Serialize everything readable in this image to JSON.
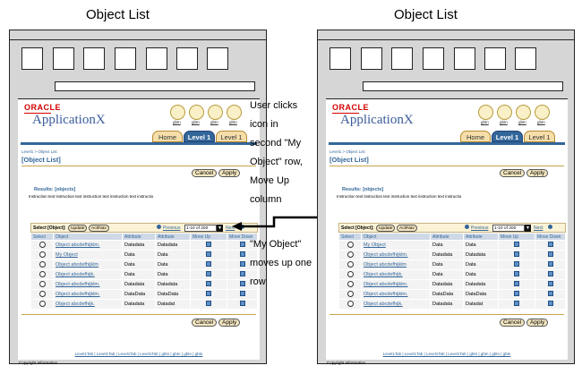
{
  "frames": [
    {
      "title": "Object List",
      "oracle": "ORACLE",
      "app": "ApplicationX",
      "globals": [
        "gbtn",
        "gbtn",
        "gbtn",
        "gbtn"
      ],
      "tabs": [
        "Home",
        "Level 1",
        "Level 1"
      ],
      "breadcrumb": "Level1 > Object List",
      "page_title": "[Object List]",
      "cancel": "Cancel",
      "apply": "Apply",
      "results": "Results: [objects]",
      "instruction": "Instruction text instruction text instruction text instruction text instructio",
      "toolbar": {
        "select": "Select [Object]:",
        "update": "Update",
        "act": "Act/Nav",
        "previous": "Previous",
        "range": "1-10 of 200",
        "next": "Next"
      },
      "columns": [
        "Select",
        "Object",
        "Attribute",
        "Attribute",
        "Move Up",
        "Move Down"
      ],
      "rows": [
        [
          "Object abcdefhijklm.",
          "Datadata",
          "Datadata"
        ],
        [
          "My Object",
          "Data",
          "Data"
        ],
        [
          "Object abcdefhijklm",
          "Data",
          "Data"
        ],
        [
          "Object abcdefhijk.",
          "Data",
          "Data"
        ],
        [
          "Object abcdefhijklm.",
          "Datadata",
          "Datadata"
        ],
        [
          "Object abcdefhijklm.",
          "DataData",
          "DataData"
        ],
        [
          "Object abcdefhijk.",
          "Datadata",
          "Datadat"
        ]
      ],
      "footer": "Level1Tab | Level1Tab | Level1Tab | Level1Tab | gbtn | gbtn | gbtn | gbtn",
      "copyright": "Copyright Information"
    },
    {
      "title": "Object List",
      "oracle": "ORACLE",
      "app": "ApplicationX",
      "globals": [
        "gbtn",
        "gbtn",
        "gbtn",
        "gbtn"
      ],
      "tabs": [
        "Home",
        "Level 1",
        "Level 1"
      ],
      "breadcrumb": "Level1 > Object List",
      "page_title": "[Object List]",
      "cancel": "Cancel",
      "apply": "Apply",
      "results": "Results: [objects]",
      "instruction": "Instruction text instruction text instruction text instruction text instructio",
      "toolbar": {
        "select": "Select [Object]:",
        "update": "Update",
        "act": "Act/Nav",
        "previous": "Previous",
        "range": "1-10 of 200",
        "next": "Next"
      },
      "columns": [
        "Select",
        "Object",
        "Attribute",
        "Attribute",
        "Move Up",
        "Move Down"
      ],
      "rows": [
        [
          "My Object",
          "Data",
          "Data"
        ],
        [
          "Object abcdefhijklm.",
          "Datadata",
          "Datadata"
        ],
        [
          "Object abcdefhijklm",
          "Data",
          "Data"
        ],
        [
          "Object abcdefhijk.",
          "Data",
          "Data"
        ],
        [
          "Object abcdefhijklm.",
          "Datadata",
          "Datadata"
        ],
        [
          "Object abcdefhijklm.",
          "DataData",
          "DataData"
        ],
        [
          "Object abcdefhijk.",
          "Datadata",
          "Datadat"
        ]
      ],
      "footer": "Level1Tab | Level1Tab | Level1Tab | Level1Tab | gbtn | gbtn | gbtn | gbtn",
      "copyright": "Copyright Information"
    }
  ],
  "annotation_action": [
    "User clicks",
    "icon in",
    "second \"My",
    "Object\" row,",
    "Move Up",
    "column"
  ],
  "annotation_result": [
    "\"My Object\"",
    "moves up one",
    "row"
  ],
  "arrow_icon": "double-headed-arrow-icon"
}
